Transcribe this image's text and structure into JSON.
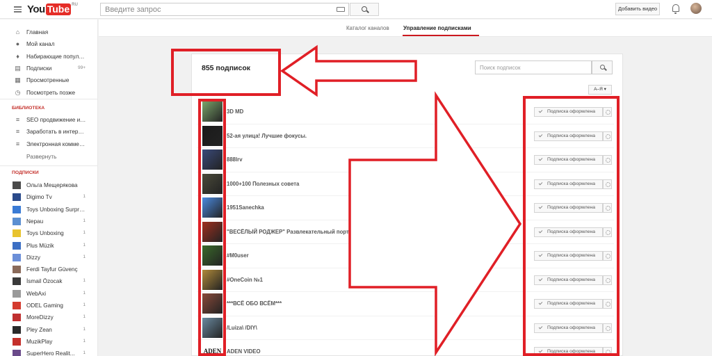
{
  "header": {
    "logo_you": "You",
    "logo_tube": "Tube",
    "logo_region": "RU",
    "search_placeholder": "Введите запрос",
    "add_video_label": "Добавить видео"
  },
  "sidebar": {
    "nav": [
      {
        "label": "Главная",
        "icon": "home-icon",
        "count": ""
      },
      {
        "label": "Мой канал",
        "icon": "user-icon",
        "count": ""
      },
      {
        "label": "Набирающие популя...",
        "icon": "flame-icon",
        "count": ""
      },
      {
        "label": "Подписки",
        "icon": "subscriptions-icon",
        "count": "99+"
      },
      {
        "label": "Просмотренные",
        "icon": "history-icon",
        "count": ""
      },
      {
        "label": "Посмотреть позже",
        "icon": "clock-icon",
        "count": ""
      }
    ],
    "library_title": "БИБЛИОТЕКА",
    "library": [
      {
        "label": "SEO продвижение и р..."
      },
      {
        "label": "Заработать в интерне..."
      },
      {
        "label": "Электронная коммер..."
      }
    ],
    "expand_label": "Развернуть",
    "subs_title": "ПОДПИСКИ",
    "subs": [
      {
        "label": "Ольга Мещерякова",
        "count": "",
        "color": "#4a4a4a"
      },
      {
        "label": "Digimo Tv",
        "count": "1",
        "color": "#2a4a8a"
      },
      {
        "label": "Toys Unboxing Surpris...",
        "count": "",
        "color": "#3a7bd5"
      },
      {
        "label": "Nepau",
        "count": "1",
        "color": "#5b8fd1"
      },
      {
        "label": "Toys Unboxing",
        "count": "1",
        "color": "#e8c32e"
      },
      {
        "label": "Plus Müzik",
        "count": "1",
        "color": "#3c6fc4"
      },
      {
        "label": "Dizzy",
        "count": "1",
        "color": "#6c8fd8"
      },
      {
        "label": "Ferdi Tayfur Güvenç",
        "count": "",
        "color": "#8a6a5a"
      },
      {
        "label": "İsmail Özocak",
        "count": "1",
        "color": "#3a3a3a"
      },
      {
        "label": "WebAxi",
        "count": "1",
        "color": "#9a9a9a"
      },
      {
        "label": "ODEL Gaming",
        "count": "1",
        "color": "#d43b2f"
      },
      {
        "label": "MoreDizzy",
        "count": "1",
        "color": "#c03030"
      },
      {
        "label": "Pley Zean",
        "count": "1",
        "color": "#2a2a2a"
      },
      {
        "label": "MuzikPlay",
        "count": "1",
        "color": "#c4302b"
      },
      {
        "label": "SuperHero Realit...",
        "count": "1",
        "color": "#6a4a8a"
      }
    ]
  },
  "tabs": [
    {
      "label": "Каталог каналов"
    },
    {
      "label": "Управление подписками"
    }
  ],
  "main": {
    "title": "855 подписок",
    "search_placeholder": "Поиск подписок",
    "sort_label": "А–Я",
    "subscribe_label": "Подписка оформлена",
    "channels": [
      {
        "name": "3D MD",
        "color": "#7aa46a"
      },
      {
        "name": "52-ая улица! Лучшие фокусы.",
        "color": "#1a1a1a"
      },
      {
        "name": "888lrv",
        "color": "#3a4a7a"
      },
      {
        "name": "1000+100 Полезных совета",
        "color": "#4a4a3a"
      },
      {
        "name": "1951Sanechka",
        "color": "#4a8ae0"
      },
      {
        "name": "\"ВЕСЁЛЫЙ РОДЖЕР\" Развлекательный портал",
        "color": "#a03020"
      },
      {
        "name": "#M0user",
        "color": "#3a6a2a"
      },
      {
        "name": "#OneCoin №1",
        "color": "#b08a3a"
      },
      {
        "name": "***ВСЁ ОБО ВСЁМ***",
        "color": "#8a4a3a"
      },
      {
        "name": "/Luiza\\ /DIY\\",
        "color": "#6a8aa0"
      },
      {
        "name": "ADEN VIDEO",
        "color": "#111111",
        "thumb_text": "ADEN"
      }
    ]
  }
}
